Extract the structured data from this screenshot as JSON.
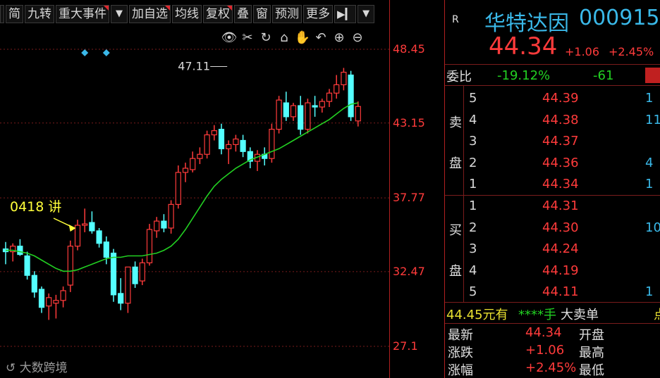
{
  "toolbar": {
    "items": [
      "简",
      "九转",
      "重大事件",
      "▼",
      "加自选",
      "均线",
      "复权",
      "叠",
      "窗",
      "预测",
      "更多"
    ],
    "play_glyph": "▶▎",
    "dropdown_glyph": "▼"
  },
  "tool_icons": [
    "eye-icon",
    "scissors-icon",
    "refresh-icon",
    "lock-icon",
    "hand-icon",
    "undo-icon",
    "zoom-in-icon",
    "zoom-out-icon"
  ],
  "chart_data": {
    "type": "candlestick",
    "y_ticks": [
      48.45,
      43.15,
      37.77,
      32.47,
      27.1
    ],
    "ylim": [
      26.3,
      50.2
    ],
    "annotations": [
      {
        "text": "47.11",
        "x_index": 31,
        "y": 47.11
      },
      {
        "text": "0418 讲",
        "x_index": 8,
        "y": 35.8
      }
    ],
    "candles": [
      {
        "o": 34.1,
        "h": 34.6,
        "l": 33.0,
        "c": 33.9
      },
      {
        "o": 33.9,
        "h": 34.5,
        "l": 33.2,
        "c": 34.3
      },
      {
        "o": 34.3,
        "h": 34.8,
        "l": 33.6,
        "c": 33.7
      },
      {
        "o": 33.6,
        "h": 33.9,
        "l": 31.9,
        "c": 32.2
      },
      {
        "o": 32.2,
        "h": 32.5,
        "l": 30.6,
        "c": 31.0
      },
      {
        "o": 31.2,
        "h": 31.4,
        "l": 29.5,
        "c": 29.9
      },
      {
        "o": 30.0,
        "h": 30.9,
        "l": 29.0,
        "c": 30.6
      },
      {
        "o": 30.2,
        "h": 30.8,
        "l": 29.1,
        "c": 30.4
      },
      {
        "o": 30.4,
        "h": 31.4,
        "l": 29.9,
        "c": 31.1
      },
      {
        "o": 31.5,
        "h": 34.7,
        "l": 31.0,
        "c": 34.3
      },
      {
        "o": 34.3,
        "h": 36.2,
        "l": 34.0,
        "c": 35.8
      },
      {
        "o": 35.8,
        "h": 37.0,
        "l": 35.3,
        "c": 35.9
      },
      {
        "o": 36.0,
        "h": 36.8,
        "l": 35.2,
        "c": 35.4
      },
      {
        "o": 35.4,
        "h": 35.6,
        "l": 34.2,
        "c": 34.5
      },
      {
        "o": 34.6,
        "h": 35.0,
        "l": 33.0,
        "c": 33.5
      },
      {
        "o": 33.8,
        "h": 34.1,
        "l": 30.3,
        "c": 30.8
      },
      {
        "o": 30.9,
        "h": 32.0,
        "l": 29.7,
        "c": 30.2
      },
      {
        "o": 30.2,
        "h": 31.2,
        "l": 29.5,
        "c": 32.8
      },
      {
        "o": 32.8,
        "h": 33.2,
        "l": 31.3,
        "c": 31.6
      },
      {
        "o": 31.8,
        "h": 33.4,
        "l": 31.5,
        "c": 33.1
      },
      {
        "o": 33.1,
        "h": 35.9,
        "l": 32.9,
        "c": 35.5
      },
      {
        "o": 35.4,
        "h": 36.4,
        "l": 34.9,
        "c": 36.1
      },
      {
        "o": 36.1,
        "h": 36.6,
        "l": 35.3,
        "c": 35.6
      },
      {
        "o": 35.6,
        "h": 37.6,
        "l": 35.2,
        "c": 37.3
      },
      {
        "o": 37.3,
        "h": 40.1,
        "l": 37.0,
        "c": 39.6
      },
      {
        "o": 39.6,
        "h": 40.3,
        "l": 38.9,
        "c": 39.9
      },
      {
        "o": 39.8,
        "h": 41.1,
        "l": 39.6,
        "c": 40.6
      },
      {
        "o": 40.6,
        "h": 41.4,
        "l": 40.2,
        "c": 40.9
      },
      {
        "o": 40.9,
        "h": 42.6,
        "l": 40.6,
        "c": 42.3
      },
      {
        "o": 42.3,
        "h": 43.0,
        "l": 41.9,
        "c": 42.6
      },
      {
        "o": 42.7,
        "h": 43.1,
        "l": 40.9,
        "c": 41.3
      },
      {
        "o": 41.3,
        "h": 41.9,
        "l": 40.2,
        "c": 41.6
      },
      {
        "o": 41.6,
        "h": 42.3,
        "l": 41.1,
        "c": 42.0
      },
      {
        "o": 41.9,
        "h": 42.3,
        "l": 40.7,
        "c": 41.1
      },
      {
        "o": 41.1,
        "h": 41.4,
        "l": 39.9,
        "c": 40.4
      },
      {
        "o": 40.4,
        "h": 41.2,
        "l": 39.7,
        "c": 40.9
      },
      {
        "o": 40.9,
        "h": 41.4,
        "l": 40.1,
        "c": 40.6
      },
      {
        "o": 40.6,
        "h": 43.1,
        "l": 40.3,
        "c": 42.7
      },
      {
        "o": 42.7,
        "h": 45.1,
        "l": 42.4,
        "c": 44.8
      },
      {
        "o": 44.6,
        "h": 45.4,
        "l": 43.3,
        "c": 43.6
      },
      {
        "o": 43.6,
        "h": 44.6,
        "l": 43.3,
        "c": 44.4
      },
      {
        "o": 44.4,
        "h": 45.1,
        "l": 42.3,
        "c": 42.7
      },
      {
        "o": 42.7,
        "h": 44.9,
        "l": 42.4,
        "c": 44.6
      },
      {
        "o": 44.4,
        "h": 45.1,
        "l": 43.6,
        "c": 44.3
      },
      {
        "o": 44.3,
        "h": 44.9,
        "l": 43.9,
        "c": 44.7
      },
      {
        "o": 44.7,
        "h": 45.6,
        "l": 44.3,
        "c": 45.3
      },
      {
        "o": 45.3,
        "h": 46.6,
        "l": 44.9,
        "c": 45.9
      },
      {
        "o": 45.9,
        "h": 47.11,
        "l": 45.5,
        "c": 46.8
      },
      {
        "o": 46.6,
        "h": 46.9,
        "l": 43.3,
        "c": 43.6
      },
      {
        "o": 43.3,
        "h": 44.7,
        "l": 42.9,
        "c": 44.34
      }
    ],
    "ma": [
      34.0,
      34.0,
      33.9,
      33.8,
      33.6,
      33.3,
      33.0,
      32.7,
      32.5,
      32.5,
      32.6,
      32.8,
      33.0,
      33.2,
      33.4,
      33.5,
      33.5,
      33.6,
      33.6,
      33.6,
      33.7,
      33.8,
      34.0,
      34.3,
      34.8,
      35.5,
      36.3,
      37.1,
      37.9,
      38.6,
      39.1,
      39.5,
      39.9,
      40.2,
      40.5,
      40.7,
      40.9,
      41.1,
      41.3,
      41.6,
      41.9,
      42.2,
      42.5,
      42.8,
      43.1,
      43.4,
      43.8,
      44.2,
      44.5,
      44.6
    ],
    "diamonds": [
      {
        "x_index": 11,
        "y": 48.4
      },
      {
        "x_index": 14,
        "y": 48.4
      }
    ]
  },
  "logo_text": "大数跨境",
  "quote": {
    "label_r": "R",
    "name": "华特达因",
    "code": "000915",
    "price": "44.34",
    "change": "+1.06",
    "change_pct": "+2.45%",
    "ratio_label": "委比",
    "ratio_value": "-19.12%",
    "ratio_diff": "-61",
    "sell_label": [
      "卖",
      "盘"
    ],
    "buy_label": [
      "买",
      "盘"
    ],
    "asks": [
      {
        "level": "5",
        "price": "44.39",
        "vol": "1"
      },
      {
        "level": "4",
        "price": "44.38",
        "vol": "11"
      },
      {
        "level": "3",
        "price": "44.37",
        "vol": ""
      },
      {
        "level": "2",
        "price": "44.36",
        "vol": "4"
      },
      {
        "level": "1",
        "price": "44.34",
        "vol": "1"
      }
    ],
    "bids": [
      {
        "level": "1",
        "price": "44.31",
        "vol": ""
      },
      {
        "level": "2",
        "price": "44.30",
        "vol": "10"
      },
      {
        "level": "3",
        "price": "44.24",
        "vol": ""
      },
      {
        "level": "4",
        "price": "44.19",
        "vol": ""
      },
      {
        "level": "5",
        "price": "44.11",
        "vol": "1"
      }
    ],
    "big_order_amount": "44.45元有",
    "big_order_hands": "****手",
    "big_order_label": "大卖单",
    "stats": [
      {
        "label": "最新",
        "value": "44.34",
        "label2": "开盘"
      },
      {
        "label": "涨跌",
        "value": "+1.06",
        "label2": "最高"
      },
      {
        "label": "涨幅",
        "value": "+2.45%",
        "label2": "最低"
      }
    ]
  }
}
